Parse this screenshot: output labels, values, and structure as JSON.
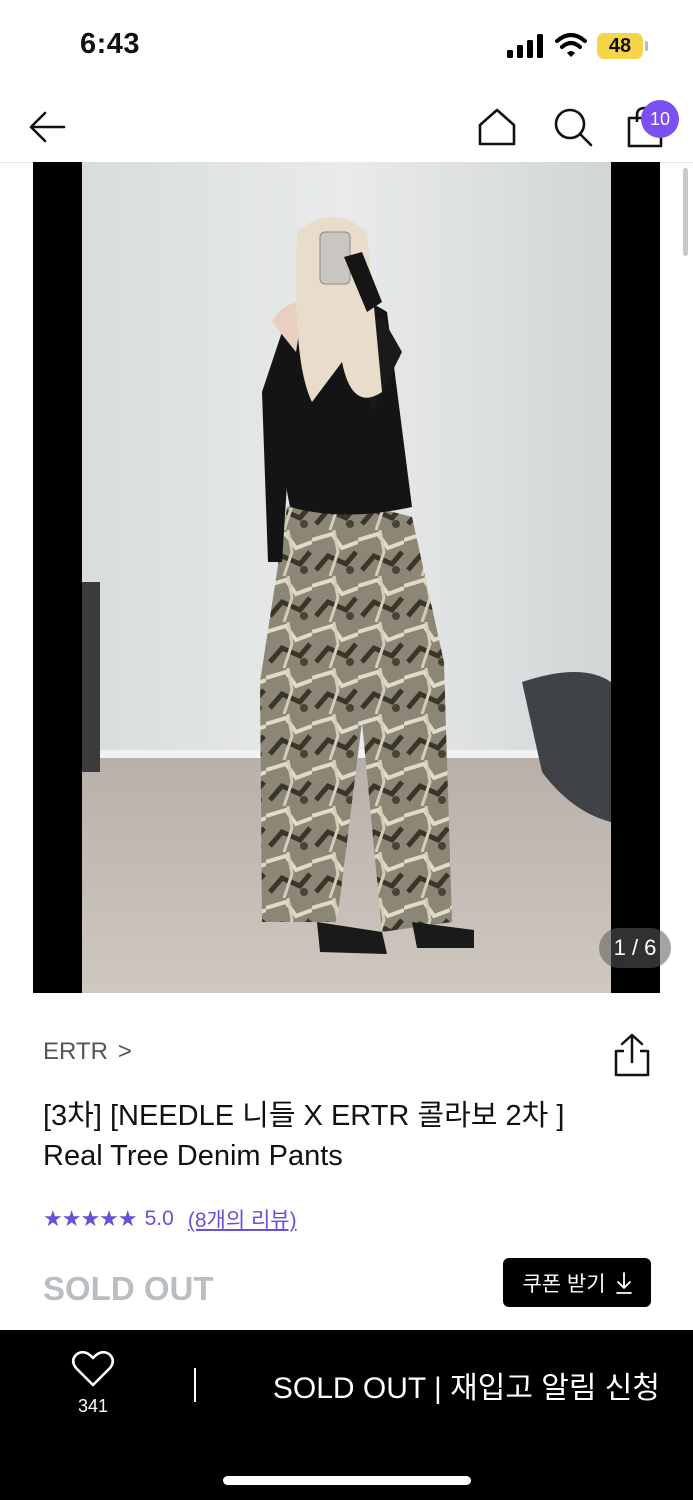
{
  "status_bar": {
    "time": "6:43",
    "battery": "48"
  },
  "nav": {
    "cart_count": "10"
  },
  "gallery": {
    "counter": "1 / 6"
  },
  "product": {
    "brand": "ERTR",
    "brand_chevron": ">",
    "title_line1": "[3차] [NEEDLE 니들 X ERTR 콜라보 2차 ]",
    "title_line2": "Real Tree Denim Pants",
    "stars": "★★★★★",
    "rating": "5.0",
    "review_link": "(8개의 리뷰)",
    "status": "SOLD OUT",
    "coupon_label": "쿠폰 받기"
  },
  "bottom_bar": {
    "like_count": "341",
    "restock_label": "SOLD OUT | 재입고 알림 신청"
  },
  "colors": {
    "accent": "#7b4ff0",
    "star": "#6b4fd8",
    "sold_out": "#b9bec3"
  }
}
